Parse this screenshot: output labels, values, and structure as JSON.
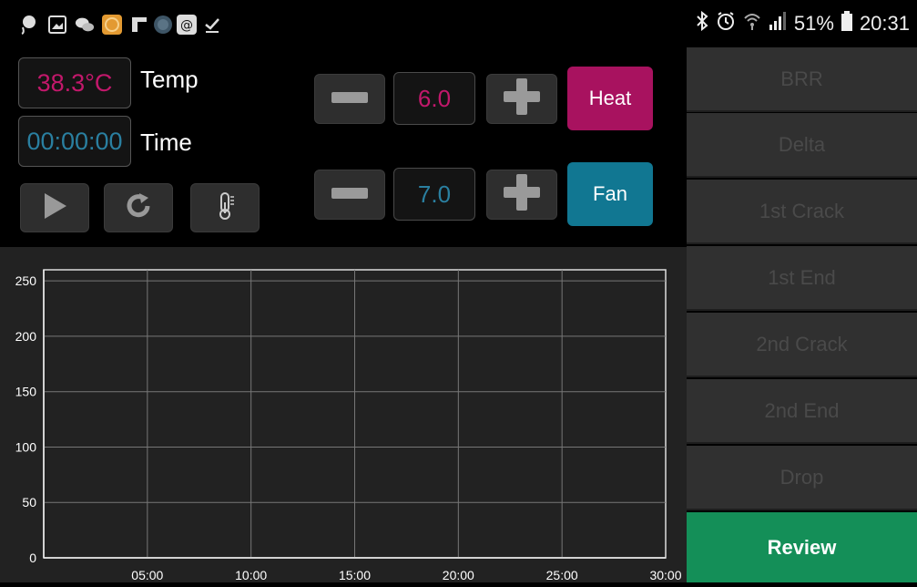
{
  "status_bar": {
    "battery": "51%",
    "time": "20:31",
    "left_icons": [
      "location-icon",
      "gallery-icon",
      "wechat-icon",
      "app-orange-icon",
      "flipboard-icon",
      "globe-icon",
      "at-sign-icon",
      "download-done-icon"
    ],
    "right_icons": [
      "bluetooth-icon",
      "alarm-icon",
      "wifi-icon",
      "signal-icon",
      "battery-icon"
    ]
  },
  "readouts": {
    "temp_value": "38.3°C",
    "temp_label": "Temp",
    "time_value": "00:00:00",
    "time_label": "Time"
  },
  "controls": {
    "heat_value": "6.0",
    "heat_label": "Heat",
    "fan_value": "7.0",
    "fan_label": "Fan",
    "play_icon": "play-icon",
    "refresh_icon": "refresh-icon",
    "thermometer_icon": "thermometer-icon"
  },
  "menu": {
    "items": [
      "BRR",
      "Delta",
      "1st Crack",
      "1st End",
      "2nd Crack",
      "2nd End",
      "Drop"
    ],
    "review": "Review"
  },
  "colors": {
    "temp": "#c2186b",
    "time": "#2a7fa0",
    "heat_button": "#a8125f",
    "fan_button": "#117792",
    "review": "#148f58"
  },
  "chart_data": {
    "type": "line",
    "title": "",
    "xlabel": "",
    "ylabel": "",
    "x_ticks": [
      "05:00",
      "10:00",
      "15:00",
      "20:00",
      "25:00",
      "30:00"
    ],
    "y_ticks": [
      "0",
      "50",
      "100",
      "150",
      "200",
      "250"
    ],
    "xlim": [
      0,
      30
    ],
    "ylim": [
      0,
      260
    ],
    "grid": true,
    "series": []
  }
}
